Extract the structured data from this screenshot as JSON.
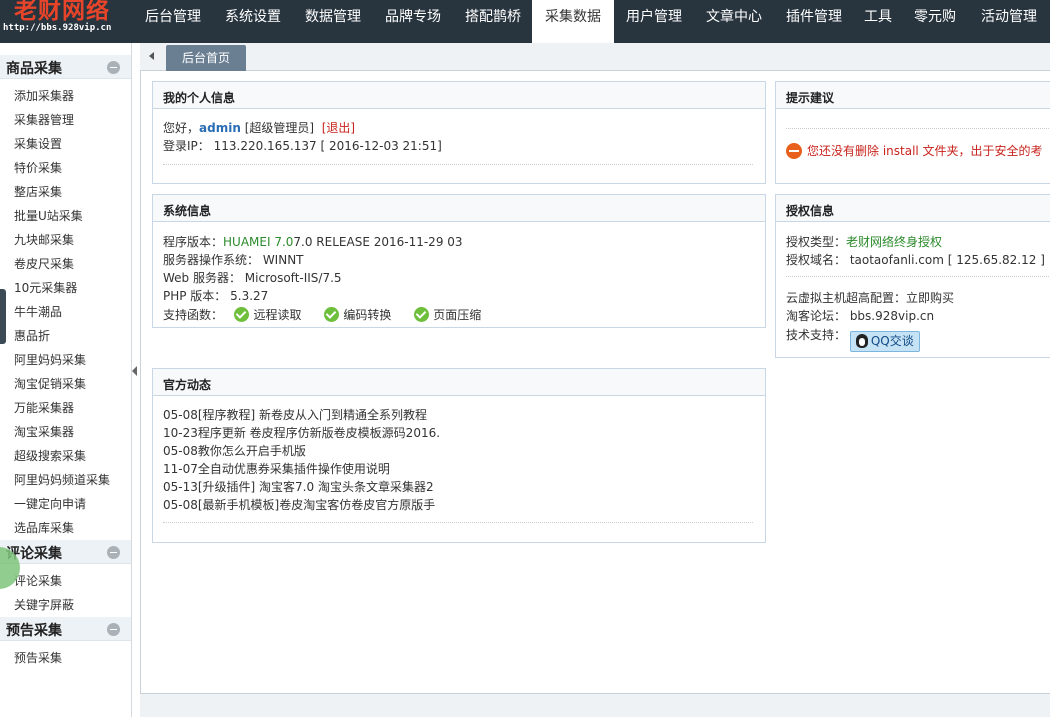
{
  "logo": {
    "brand": "老财网络",
    "url": "http://bbs.928vip.cn"
  },
  "nav": {
    "items": [
      "后台管理",
      "系统设置",
      "数据管理",
      "品牌专场",
      "搭配鹊桥",
      "采集数据",
      "用户管理",
      "文章中心",
      "插件管理",
      "工具",
      "零元购",
      "活动管理"
    ],
    "active": "采集数据"
  },
  "sidebar": {
    "group1": {
      "title": "商品采集",
      "items": [
        "添加采集器",
        "采集器管理",
        "采集设置",
        "特价采集",
        "整店采集",
        "批量U站采集",
        "九块邮采集",
        "卷皮尺采集",
        "10元采集器",
        "牛牛潮品",
        "惠品折",
        "阿里妈妈采集",
        "淘宝促销采集",
        "万能采集器",
        "淘宝采集器",
        "超级搜索采集",
        "阿里妈妈频道采集",
        "一键定向申请",
        "选品库采集"
      ]
    },
    "group2": {
      "title": "评论采集",
      "items": [
        "评论采集",
        "关键字屏蔽"
      ]
    },
    "group3": {
      "title": "预告采集",
      "items": [
        "预告采集"
      ]
    }
  },
  "tab": {
    "label": "后台首页"
  },
  "personal": {
    "title": "我的个人信息",
    "hello": "您好，",
    "user": "admin",
    "role": "[超级管理员]",
    "logout": "[退出]",
    "login_ip_label": "登录IP：",
    "login_ip": "113.220.165.137 [ 2016-12-03 21:51]"
  },
  "tips": {
    "title": "提示建议",
    "warning": "您还没有删除 install 文件夹，出于安全的考"
  },
  "sysinfo": {
    "title": "系统信息",
    "version_label": "程序版本：",
    "version_green": "HUAMEI 7.0",
    "version_rest": "7.0 RELEASE 2016-11-29 03",
    "os": "服务器操作系统：  WINNT",
    "web": "Web 服务器：  Microsoft-IIS/7.5",
    "php": "PHP 版本：  5.3.27",
    "funcs_label": "支持函数：",
    "funcs": [
      "远程读取",
      "编码转换",
      "页面压缩"
    ]
  },
  "license": {
    "title": "授权信息",
    "type_label": "授权类型：",
    "type_value": "老财网络终身授权",
    "domain": "授权域名：  taotaofanli.com [ 125.65.82.12 ]",
    "host_label": "云虚拟主机超高配置：",
    "host_link": "立即购买",
    "forum": "淘客论坛：  bbs.928vip.cn",
    "support_label": "技术支持：",
    "qq": "QQ交谈"
  },
  "news": {
    "title": "官方动态",
    "items": [
      "05-08[程序教程] 新卷皮从入门到精通全系列教程",
      "10-23程序更新 卷皮程序仿新版卷皮模板源码2016.",
      "05-08教你怎么开启手机版",
      "11-07全自动优惠券采集插件操作使用说明",
      "05-13[升级插件] 淘宝客7.0 淘宝头条文章采集器2",
      "05-08[最新手机模板]卷皮淘宝客仿卷皮官方原版手"
    ]
  },
  "colors": {
    "topbar": "#28353f",
    "accent_red": "#e8442a",
    "tab": "#6b7f93",
    "green": "#2b8a2b"
  }
}
